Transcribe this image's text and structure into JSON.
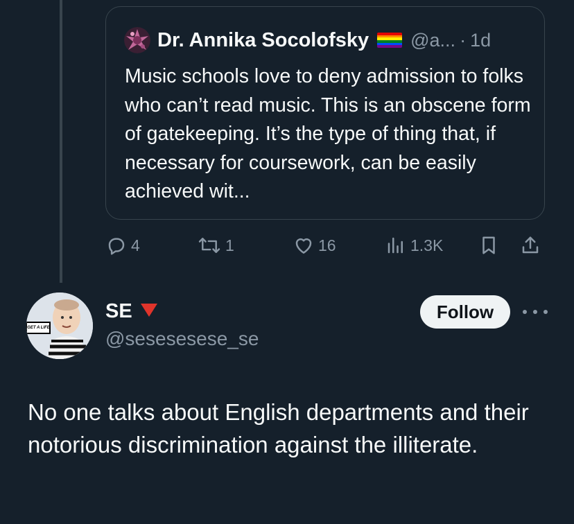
{
  "quoted_tweet": {
    "author_name": "Dr. Annika Socolofsky",
    "author_handle": "@a...",
    "separator": "·",
    "time": "1d",
    "flag_colors": [
      "#e40303",
      "#ff8c00",
      "#ffed00",
      "#008026",
      "#004dff",
      "#750787"
    ],
    "text": "Music schools love to deny admission to folks who can’t read music. This is an obscene form of gatekeeping. It’s the type of thing that, if necessary for coursework, can be easily achieved wit..."
  },
  "actions": {
    "reply_count": "4",
    "retweet_count": "1",
    "like_count": "16",
    "views_count": "1.3K",
    "icons": [
      "reply-icon",
      "retweet-icon",
      "like-icon",
      "views-icon",
      "bookmark-icon",
      "share-icon"
    ]
  },
  "reply": {
    "author_name": "SE",
    "author_handle": "@sesesesese_se",
    "follow_label": "Follow",
    "avatar_text": "GET A LIFE",
    "text": "No one talks about English departments and their notorious discrimination against the illiterate."
  },
  "colors": {
    "background": "#15202b",
    "text_primary": "#f7f9f9",
    "text_secondary": "#8b98a5",
    "border": "#38444d",
    "follow_bg": "#eff3f4",
    "red_triangle": "#e0342b"
  }
}
